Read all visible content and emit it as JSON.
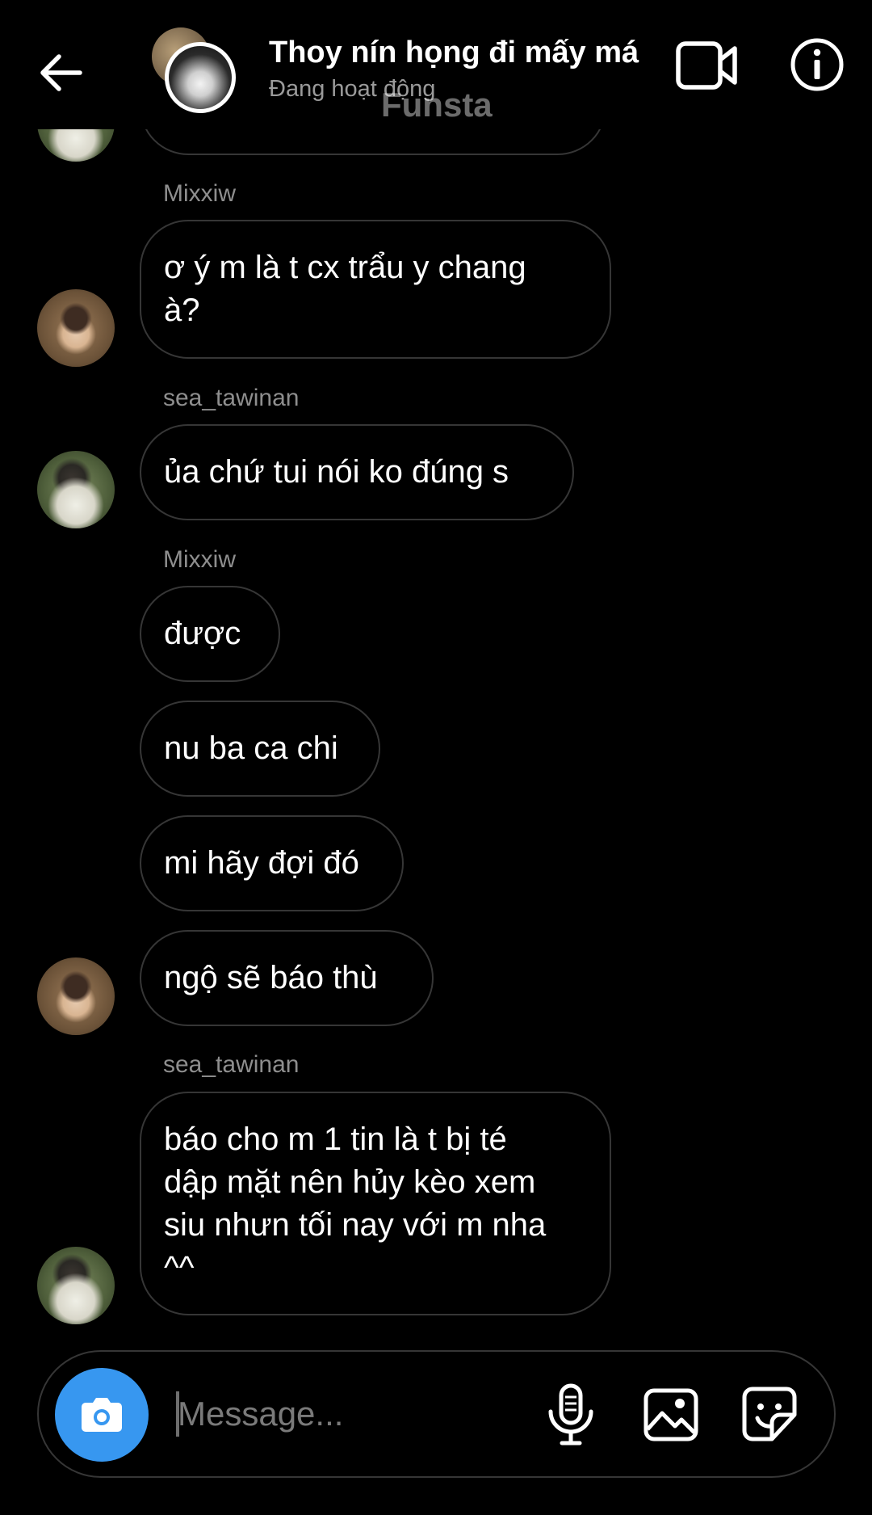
{
  "header": {
    "title": "Thoy nín họng đi mấy má",
    "status": "Đang hoạt động",
    "watermark": "Funsta",
    "icons": {
      "back": "arrow-left-icon",
      "video": "video-camera-icon",
      "info": "info-icon"
    }
  },
  "messages": {
    "senders": {
      "mixxiw_1": "Mixxiw",
      "sea_1": "sea_tawinan",
      "mixxiw_2": "Mixxiw",
      "sea_2": "sea_tawinan"
    },
    "bubbles": {
      "m1": "ơ ý m là t cx trẩu y chang\nà?",
      "m2": "ủa chứ tui nói ko đúng s",
      "m3": "được",
      "m4": "nu ba ca chi",
      "m5": "mi hãy đợi đó",
      "m6": "ngộ sẽ báo thù",
      "m7": "báo cho m 1 tin là t bị té\ndập mặt nên hủy kèo xem\nsiu nhưn tối nay với m nha\n^^"
    }
  },
  "composer": {
    "placeholder": "Message...",
    "value": "",
    "icons": {
      "camera": "camera-icon",
      "mic": "microphone-icon",
      "gallery": "image-icon",
      "sticker": "sticker-icon"
    }
  },
  "colors": {
    "background": "#000000",
    "bubble_border": "#363636",
    "secondary_text": "#8e8e8e",
    "camera_button": "#3797f0"
  }
}
